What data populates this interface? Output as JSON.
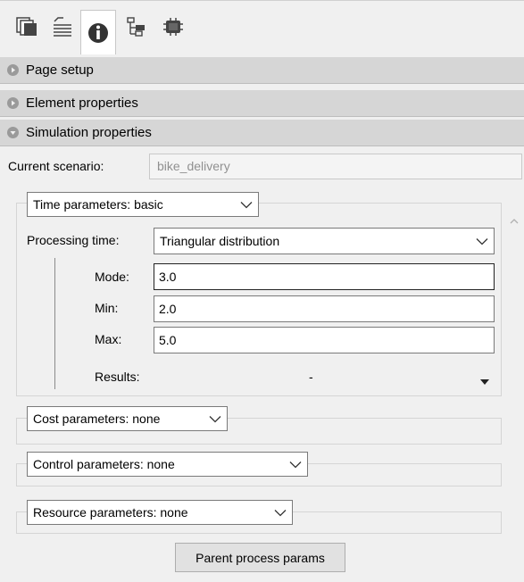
{
  "toolbar": {
    "icons": [
      "pages-icon",
      "document-icon",
      "info-icon",
      "tree-icon",
      "chip-icon"
    ],
    "active_index": 2
  },
  "sections": {
    "page_setup": "Page setup",
    "element_properties": "Element properties",
    "simulation_properties": "Simulation properties"
  },
  "scenario": {
    "label": "Current scenario:",
    "value": "bike_delivery"
  },
  "time": {
    "dropdown": "Time parameters: basic",
    "processing_label": "Processing time:",
    "processing_value": "Triangular distribution",
    "mode_label": "Mode:",
    "mode_value": "3.0",
    "min_label": "Min:",
    "min_value": "2.0",
    "max_label": "Max:",
    "max_value": "5.0",
    "results_label": "Results:",
    "results_value": "-"
  },
  "cost": {
    "dropdown": "Cost parameters: none"
  },
  "control": {
    "dropdown": "Control parameters: none"
  },
  "resource": {
    "dropdown": "Resource parameters: none"
  },
  "buttons": {
    "parent_process": "Parent process params"
  },
  "colors": {
    "header_bg": "#d6d6d6",
    "panel_bg": "#f0f0f0"
  }
}
